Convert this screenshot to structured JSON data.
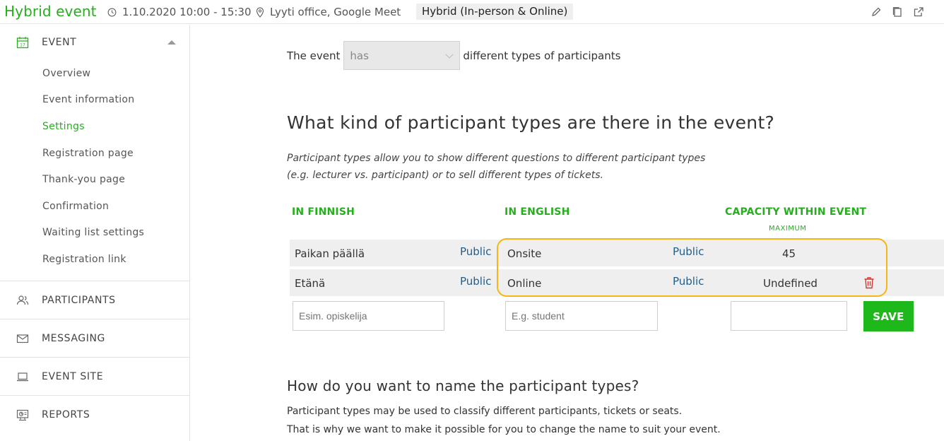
{
  "header": {
    "title": "Hybrid event",
    "datetime": "1.10.2020 10:00 - 15:30",
    "location": "Lyyti office, Google Meet",
    "mode_badge": "Hybrid (In-person & Online)"
  },
  "sidebar": {
    "event_section": "EVENT",
    "event_items": [
      "Overview",
      "Event information",
      "Settings",
      "Registration page",
      "Thank-you page",
      "Confirmation",
      "Waiting list settings",
      "Registration link"
    ],
    "active_item": "Settings",
    "sections": [
      "PARTICIPANTS",
      "MESSAGING",
      "EVENT SITE",
      "REPORTS"
    ]
  },
  "main": {
    "sentence_before": "The event",
    "select_value": "has",
    "sentence_after": "different types of participants",
    "heading": "What kind of participant types are there in the event?",
    "description_line1": "Participant types allow you to show different questions to different participant types",
    "description_line2": "(e.g. lecturer vs. participant) or to sell different types of tickets.",
    "columns": {
      "finnish": "IN FINNISH",
      "english": "IN ENGLISH",
      "capacity": "CAPACITY WITHIN EVENT",
      "capacity_sub": "MAXIMUM"
    },
    "rows": [
      {
        "fi": "Paikan päällä",
        "fi_status": "Public",
        "en": "Onsite",
        "en_status": "Public",
        "capacity": "45"
      },
      {
        "fi": "Etänä",
        "fi_status": "Public",
        "en": "Online",
        "en_status": "Public",
        "capacity": "Undefined"
      }
    ],
    "new_row": {
      "fi_placeholder": "Esim. opiskelija",
      "en_placeholder": "E.g. student",
      "capacity_placeholder": "",
      "save_label": "SAVE"
    },
    "heading2": "How do you want to name the participant types?",
    "para_line1": "Participant types may be used to classify different participants, tickets or seats.",
    "para_line2": "That is why we want to make it possible for you to change the name to suit your event."
  },
  "colors": {
    "accent": "#27ae1f",
    "link": "#1f5e8c",
    "highlight": "#f5b619",
    "delete": "#d9342b"
  }
}
